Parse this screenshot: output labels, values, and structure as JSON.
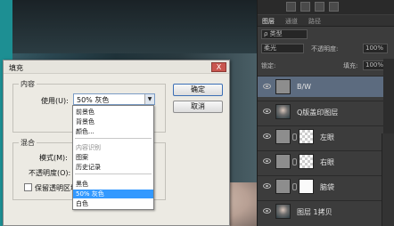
{
  "dialog": {
    "title": "填充",
    "close_label": "X",
    "content_group": "内容",
    "use_label": "使用(U):",
    "use_value": "50% 灰色",
    "ok_label": "确定",
    "cancel_label": "取消",
    "blend_group": "混合",
    "mode_label": "模式(M):",
    "opacity_label": "不透明度(O):",
    "preserve_label": "保留透明区域"
  },
  "dropdown": {
    "items": [
      {
        "label": "前景色",
        "state": "normal"
      },
      {
        "label": "背景色",
        "state": "normal"
      },
      {
        "label": "颜色...",
        "state": "normal"
      },
      {
        "label": "内容识别",
        "state": "disabled"
      },
      {
        "label": "图案",
        "state": "normal"
      },
      {
        "label": "历史记录",
        "state": "normal"
      },
      {
        "label": "黑色",
        "state": "normal"
      },
      {
        "label": "50% 灰色",
        "state": "selected"
      },
      {
        "label": "白色",
        "state": "normal"
      }
    ]
  },
  "ps_panel": {
    "tabs": [
      "图层",
      "通道",
      "路径"
    ],
    "kind_filter": "ρ 类型",
    "blend_mode": "柔光",
    "opacity_label": "不透明度:",
    "opacity_value": "100%",
    "lock_label": "锁定:",
    "fill_label": "填充:",
    "fill_value": "100%",
    "layers": [
      {
        "name": "B/W",
        "thumb": "gray",
        "selected": true
      },
      {
        "name": "Q版盖印图层",
        "thumb": "portrait",
        "selected": false
      },
      {
        "name": "左眼",
        "thumb": "checker",
        "selected": false
      },
      {
        "name": "右眼",
        "thumb": "checker",
        "selected": false
      },
      {
        "name": "脑袋",
        "thumb": "white",
        "selected": false
      },
      {
        "name": "图层 1拷贝",
        "thumb": "portrait",
        "selected": false
      }
    ]
  },
  "colors": {
    "selection_blue": "#3399ff",
    "layer_selected": "#5c6b7f",
    "close_red": "#c9564f"
  }
}
